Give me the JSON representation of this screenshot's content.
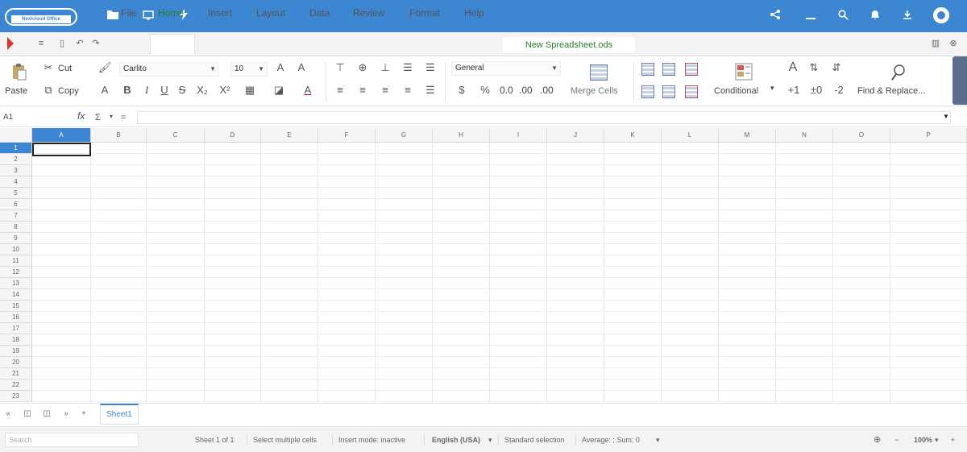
{
  "topbar": {
    "logo_text": "Nextcloud Office",
    "icons": [
      "folder-icon",
      "screen-icon",
      "activity-icon",
      "share-icon",
      "minimize-icon",
      "search-icon",
      "notifications-icon",
      "download-icon",
      "user-avatar-icon"
    ],
    "bg": "#3d86d2"
  },
  "menubar": {
    "items": [
      "File",
      "Home",
      "Insert",
      "Layout",
      "Data",
      "Review",
      "Format",
      "Help"
    ],
    "active": "Home",
    "document_name": "New Spreadsheet.ods"
  },
  "ribbon": {
    "paste": "Paste",
    "cut": "Cut",
    "copy": "Copy",
    "font_name": "Carlito",
    "font_size": "10",
    "bold": "B",
    "italic": "I",
    "underline": "U",
    "strike": "S",
    "subscript": "X₂",
    "superscript": "X²",
    "number_format": "General",
    "percent": "%",
    "decimal_formats": [
      "0.0",
      ".00",
      ".00"
    ],
    "merge_cells": "Merge Cells",
    "conditional": "Conditional",
    "find_replace": "Find & Replace..."
  },
  "formulabar": {
    "name_box": "A1",
    "fx": "fx",
    "sum": "Σ",
    "equals": "="
  },
  "grid": {
    "columns": [
      "A",
      "B",
      "C",
      "D",
      "E",
      "F",
      "G",
      "H",
      "I",
      "J",
      "K",
      "L",
      "M",
      "N",
      "O",
      "P"
    ],
    "rows": [
      "1",
      "2",
      "3",
      "4",
      "5",
      "6",
      "7",
      "8",
      "9",
      "10",
      "11",
      "12",
      "13",
      "14",
      "15",
      "16",
      "17",
      "18",
      "19",
      "20",
      "21",
      "22",
      "23"
    ],
    "selected_cell": "A1"
  },
  "sheets": {
    "tabs": [
      "Sheet1"
    ],
    "active": "Sheet1"
  },
  "statusbar": {
    "search_placeholder": "Search",
    "sheet_position": "Sheet 1 of 1",
    "selection_mode": "Select multiple cells",
    "insert_mode": "Insert mode: inactive",
    "language": "English (USA)",
    "selection": "Standard selection",
    "aggregate": "Average: ; Sum: 0",
    "zoom": "100%"
  }
}
